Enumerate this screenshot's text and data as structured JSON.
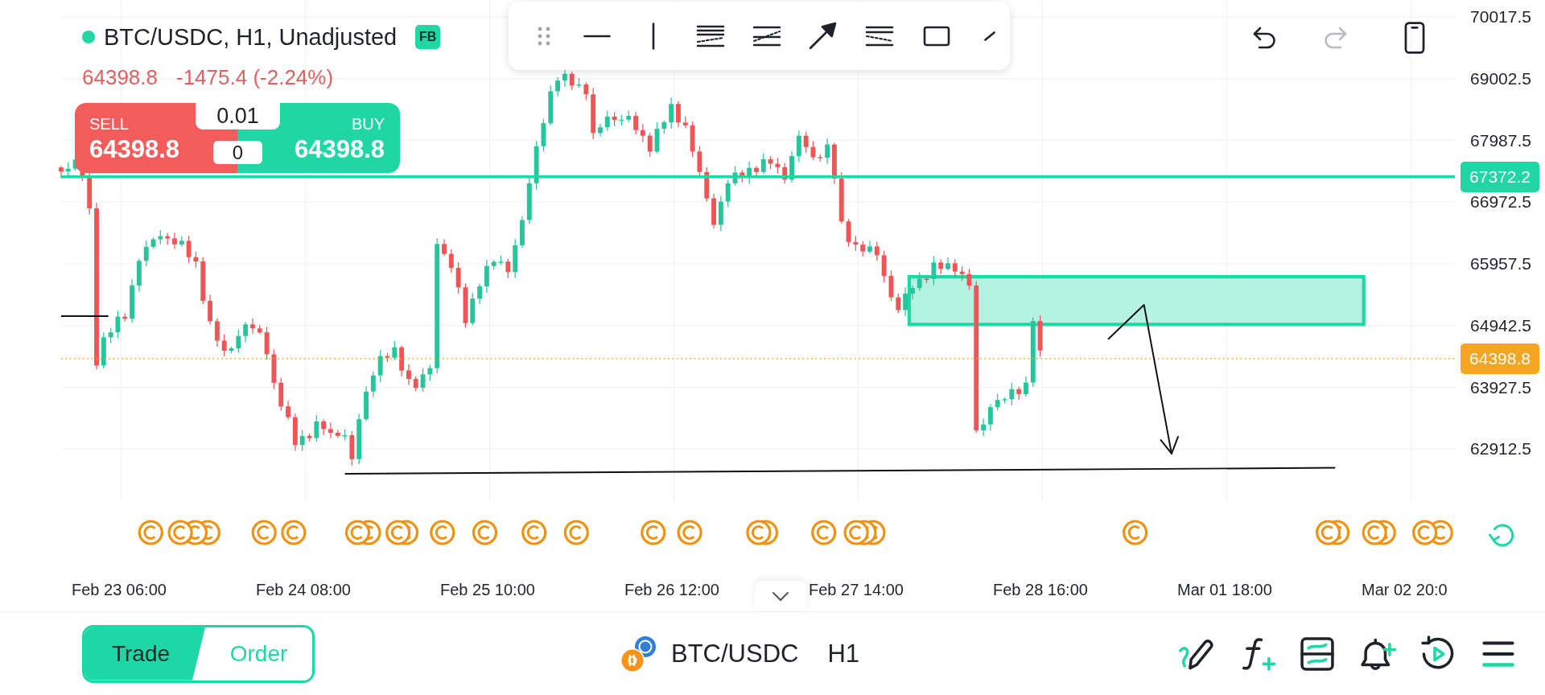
{
  "header": {
    "title": "BTC/USDC, H1, Unadjusted",
    "badge": "FB",
    "price": "64398.8",
    "change": "-1475.4 (-2.24%)"
  },
  "trade_panel": {
    "sell": {
      "label": "SELL",
      "price": "64398.8"
    },
    "lot_size": "0.01",
    "spread": "0",
    "buy": {
      "label": "BUY",
      "price": "64398.8"
    }
  },
  "history": {
    "undo": {
      "disabled": false
    },
    "redo": {
      "disabled": true
    }
  },
  "price_axis": {
    "ticks": [
      "70017.5",
      "69002.5",
      "67987.5",
      "66972.5",
      "65957.5",
      "64942.5",
      "63927.5",
      "62912.5"
    ],
    "markers": [
      {
        "kind": "horizontal_line",
        "value": "67372.2",
        "color": "#21d6a5"
      },
      {
        "kind": "last_price",
        "value": "64398.8",
        "color": "#f4a522"
      }
    ]
  },
  "time_axis": [
    "Feb 23 06:00",
    "Feb 24 08:00",
    "Feb 25 10:00",
    "Feb 26 12:00",
    "Feb 27 14:00",
    "Feb 28 16:00",
    "Mar 01 18:00",
    "Mar 02 20:0"
  ],
  "bottom_bar": {
    "tabs": [
      {
        "label": "Trade",
        "selected": true
      },
      {
        "label": "Order",
        "selected": false
      }
    ],
    "symbol": "BTC/USDC",
    "timeframe": "H1"
  }
}
